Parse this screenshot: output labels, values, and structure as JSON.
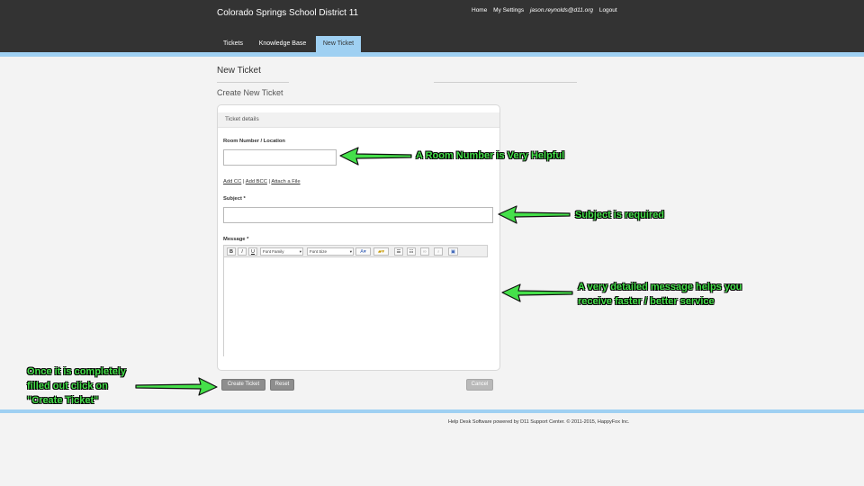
{
  "header": {
    "brand": "Colorado Springs School District 11",
    "links": {
      "home": "Home",
      "settings": "My Settings",
      "email": "jason.reynolds@d11.org",
      "logout": "Logout"
    },
    "tabs": [
      {
        "label": "Tickets"
      },
      {
        "label": "Knowledge Base"
      },
      {
        "label": "New Ticket",
        "active": true
      }
    ]
  },
  "page": {
    "title": "New Ticket",
    "subtitle": "Create New Ticket"
  },
  "form": {
    "panel_title": "Ticket details",
    "room_label": "Room Number / Location",
    "room_value": "",
    "link_cc": "Add CC",
    "link_bcc": "Add BCC",
    "link_attach": "Attach a File",
    "subject_label": "Subject *",
    "subject_value": "",
    "message_label": "Message *",
    "message_value": "",
    "toolbar": {
      "bold": "B",
      "italic": "I",
      "underline": "U",
      "font_family": "Font Family",
      "font_size": "Font Size"
    }
  },
  "buttons": {
    "create": "Create Ticket",
    "reset": "Reset",
    "cancel": "Cancel"
  },
  "footer": {
    "text": "Help Desk Software powered by D11 Support Center. © 2011-2015, HappyFox Inc."
  },
  "annotations": {
    "room": "A Room Number is Very Helpful",
    "subject": "Subject is required",
    "message_line1": "A very detailed message helps you",
    "message_line2": "receive faster / better service",
    "create_line1": "Once it is completely",
    "create_line2": "filled out click on",
    "create_line3": "\"Create Ticket\""
  },
  "colors": {
    "header_bg": "#333333",
    "accent_blue": "#9fd0f2",
    "annotation_green": "#45e04a",
    "page_bg": "#f3f3f3"
  }
}
